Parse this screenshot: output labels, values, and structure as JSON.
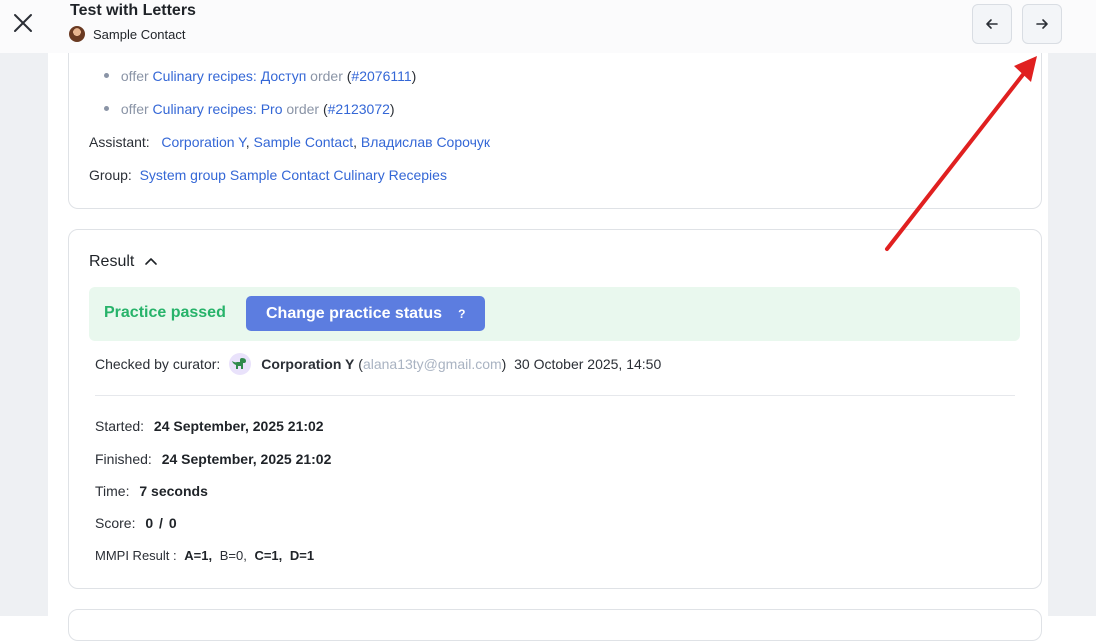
{
  "header": {
    "title": "Test with Letters",
    "contact_name": "Sample Contact",
    "prev_icon": "arrow-left-icon",
    "next_icon": "arrow-right-icon",
    "close_icon": "close-icon"
  },
  "details": {
    "offers": [
      {
        "prefix": "offer",
        "name": "Culinary recipes: Доступ",
        "order_word": "order",
        "open": "(",
        "order_id": "#2076111",
        "close": ")"
      },
      {
        "prefix": "offer",
        "name": "Culinary recipes: Pro",
        "order_word": "order",
        "open": "(",
        "order_id": "#2123072",
        "close": ")"
      }
    ],
    "assistant_label": "Assistant:",
    "assistants": [
      "Corporation Y",
      "Sample Contact",
      "Владислав Сорочук"
    ],
    "group_label": "Group:",
    "group_value": "System group Sample Contact Culinary Recepies"
  },
  "result": {
    "heading": "Result",
    "status_text": "Practice passed",
    "change_button": "Change practice status",
    "help_mark": "?",
    "curator_label": "Checked by curator:",
    "curator_name": "Corporation Y",
    "curator_email": "alana13ty@gmail.com",
    "checked_at": "30 October 2025, 14:50",
    "started_label": "Started:",
    "started_value": "24 September, 2025 21:02",
    "finished_label": "Finished:",
    "finished_value": "24 September, 2025 21:02",
    "time_label": "Time:",
    "time_value": "7 seconds",
    "score_label": "Score:",
    "score_value": "0",
    "score_sep": "/",
    "score_max": "0",
    "mmpi_label": "MMPI Result :",
    "mmpi_values": [
      "A=1,",
      "B=0,",
      "C=1,",
      "D=1"
    ]
  },
  "colors": {
    "link": "#3467d6",
    "success": "#27b36a",
    "success_bg": "#e9f8ee",
    "button": "#5c7de0",
    "annotation_arrow": "#e02020"
  }
}
